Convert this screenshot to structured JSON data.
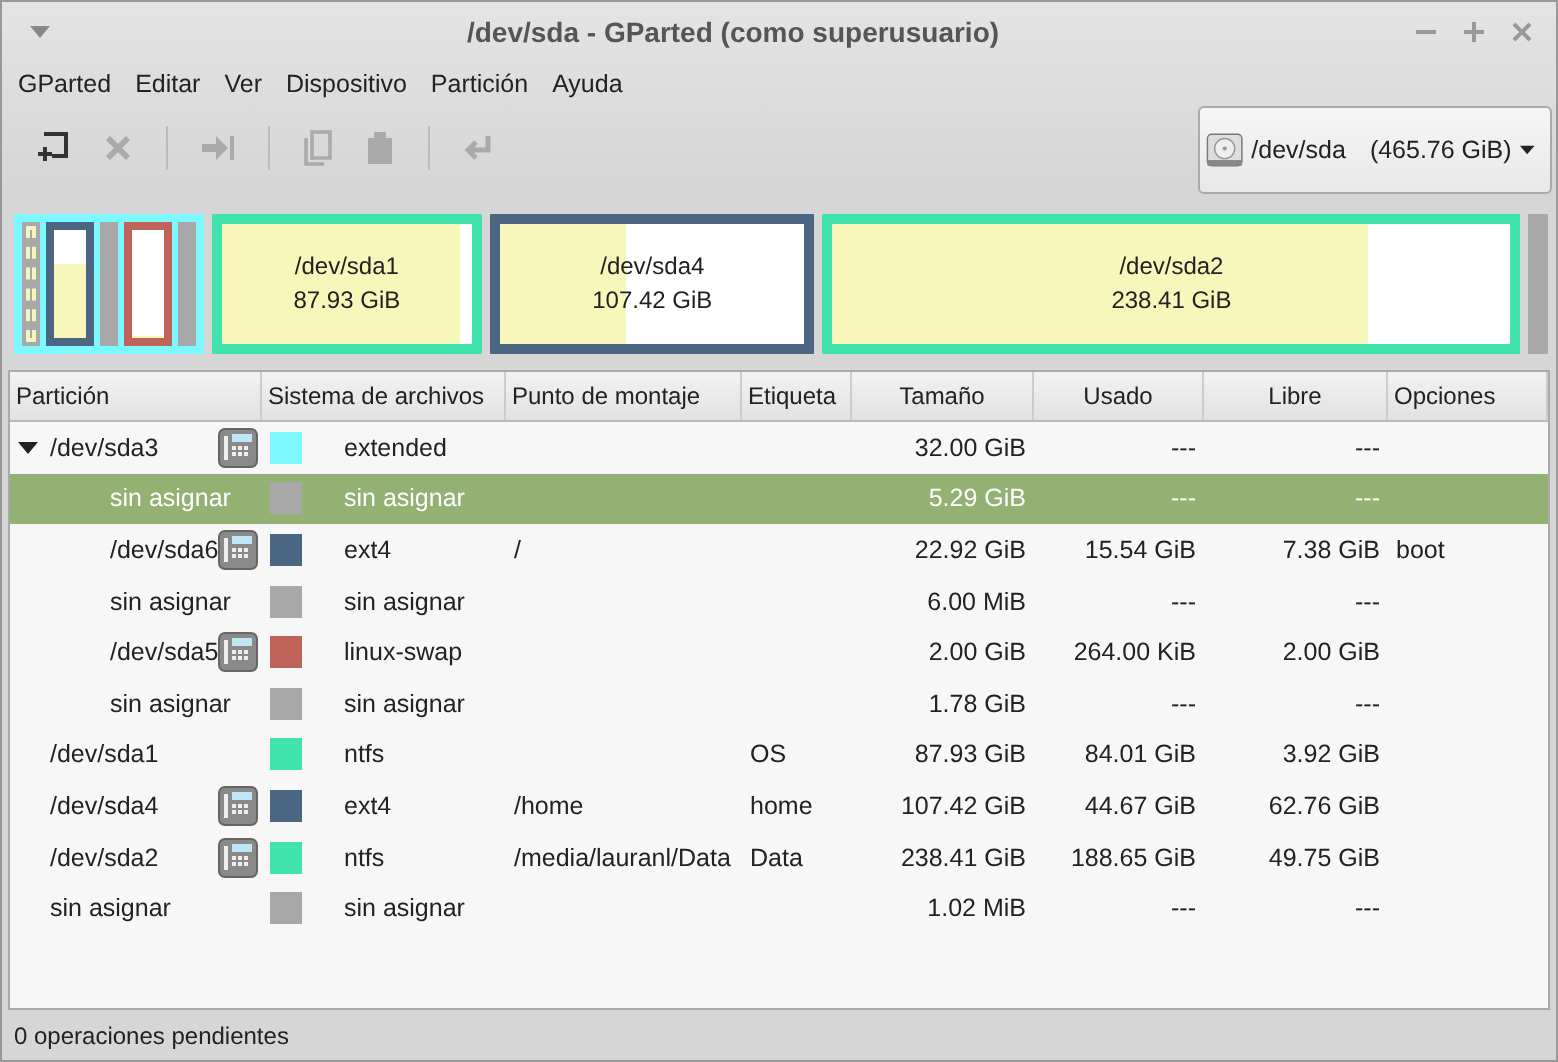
{
  "window": {
    "title": "/dev/sda - GParted (como superusuario)"
  },
  "menu": [
    "GParted",
    "Editar",
    "Ver",
    "Dispositivo",
    "Partición",
    "Ayuda"
  ],
  "toolbar": [
    {
      "kind": "new",
      "disabled": false
    },
    {
      "kind": "delete",
      "disabled": true
    },
    {
      "kind": "resize",
      "disabled": true
    },
    {
      "kind": "copy",
      "disabled": true
    },
    {
      "kind": "paste",
      "disabled": true
    },
    {
      "kind": "undo",
      "disabled": true
    }
  ],
  "device": {
    "name": "/dev/sda",
    "size": "(465.76 GiB)"
  },
  "disk_map": [
    {
      "kind": "extended",
      "color": "#7df8ff",
      "children": [
        {
          "kind": "unallocated",
          "selected": true
        },
        {
          "kind": "partition",
          "color": "#4a6683",
          "level": 0.68,
          "selected": false
        },
        {
          "kind": "unallocated",
          "selected": false
        },
        {
          "kind": "partition",
          "color": "#c0645a",
          "level": 0.01,
          "selected": false
        },
        {
          "kind": "unallocated",
          "selected": false
        }
      ]
    },
    {
      "kind": "partition",
      "name": "/dev/sda1",
      "size": "87.93 GiB",
      "color": "#41e3ac",
      "level": 0.955,
      "selected": false
    },
    {
      "kind": "partition",
      "name": "/dev/sda4",
      "size": "107.42 GiB",
      "color": "#4a6683",
      "level": 0.416,
      "selected": false
    },
    {
      "kind": "partition",
      "name": "/dev/sda2",
      "size": "238.41 GiB",
      "color": "#41e3ac",
      "level": 0.79,
      "selected": false
    },
    {
      "kind": "unallocated",
      "selected": false
    }
  ],
  "table": {
    "columns": [
      "Partición",
      "Sistema de archivos",
      "Punto de montaje",
      "Etiqueta",
      "Tamaño",
      "Usado",
      "Libre",
      "Opciones"
    ],
    "rows": [
      {
        "partition": "/dev/sda3",
        "locked": true,
        "color": "#7df8ff",
        "filesystem": "extended",
        "size": "32.00 GiB",
        "used": "---",
        "free": "---",
        "selected": false,
        "expanded": true,
        "children": [
          {
            "partition": "sin asignar",
            "locked": false,
            "color": "#a8a8a8",
            "filesystem": "sin asignar",
            "size": "5.29 GiB",
            "used": "---",
            "free": "---",
            "selected": true
          },
          {
            "partition": "/dev/sda6",
            "locked": true,
            "color": "#4a6683",
            "filesystem": "ext4",
            "mount": "/",
            "size": "22.92 GiB",
            "used": "15.54 GiB",
            "free": "7.38 GiB",
            "flags": "boot",
            "selected": false
          },
          {
            "partition": "sin asignar",
            "locked": false,
            "color": "#a8a8a8",
            "filesystem": "sin asignar",
            "size": "6.00 MiB",
            "used": "---",
            "free": "---",
            "selected": false
          },
          {
            "partition": "/dev/sda5",
            "locked": true,
            "color": "#c0645a",
            "filesystem": "linux-swap",
            "size": "2.00 GiB",
            "used": "264.00 KiB",
            "free": "2.00 GiB",
            "selected": false
          },
          {
            "partition": "sin asignar",
            "locked": false,
            "color": "#a8a8a8",
            "filesystem": "sin asignar",
            "size": "1.78 GiB",
            "used": "---",
            "free": "---",
            "selected": false
          }
        ]
      },
      {
        "partition": "/dev/sda1",
        "locked": false,
        "color": "#41e3ac",
        "filesystem": "ntfs",
        "label": "OS",
        "size": "87.93 GiB",
        "used": "84.01 GiB",
        "free": "3.92 GiB",
        "selected": false
      },
      {
        "partition": "/dev/sda4",
        "locked": true,
        "color": "#4a6683",
        "filesystem": "ext4",
        "mount": "/home",
        "label": "home",
        "size": "107.42 GiB",
        "used": "44.67 GiB",
        "free": "62.76 GiB",
        "selected": false
      },
      {
        "partition": "/dev/sda2",
        "locked": true,
        "color": "#41e3ac",
        "filesystem": "ntfs",
        "mount": "/media/lauranl/Data",
        "label": "Data",
        "size": "238.41 GiB",
        "used": "188.65 GiB",
        "free": "49.75 GiB",
        "selected": false
      },
      {
        "partition": "sin asignar",
        "locked": false,
        "color": "#a8a8a8",
        "filesystem": "sin asignar",
        "size": "1.02 MiB",
        "used": "---",
        "free": "---",
        "selected": false
      }
    ]
  },
  "status_bar": "0 operaciones pendientes"
}
